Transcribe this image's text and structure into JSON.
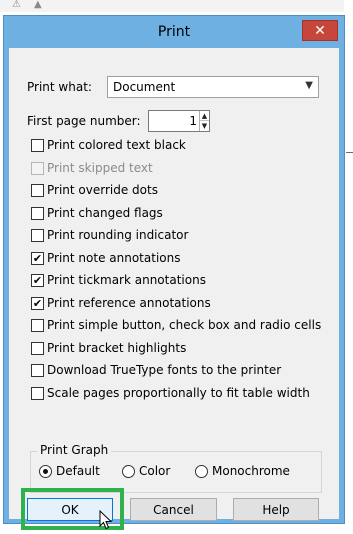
{
  "dialog": {
    "title": "Print",
    "close_glyph": "✕"
  },
  "print_what": {
    "label": "Print what:",
    "value": "Document"
  },
  "first_page": {
    "label": "First page number:",
    "value": "1"
  },
  "options": [
    {
      "label": "Print colored text black",
      "checked": false,
      "enabled": true
    },
    {
      "label": "Print skipped text",
      "checked": false,
      "enabled": false
    },
    {
      "label": "Print override dots",
      "checked": false,
      "enabled": true
    },
    {
      "label": "Print changed flags",
      "checked": false,
      "enabled": true
    },
    {
      "label": "Print rounding indicator",
      "checked": false,
      "enabled": true
    },
    {
      "label": "Print note annotations",
      "checked": true,
      "enabled": true
    },
    {
      "label": "Print tickmark annotations",
      "checked": true,
      "enabled": true
    },
    {
      "label": "Print reference annotations",
      "checked": true,
      "enabled": true
    },
    {
      "label": "Print simple button, check box and radio cells",
      "checked": false,
      "enabled": true
    },
    {
      "label": "Print bracket highlights",
      "checked": false,
      "enabled": true
    },
    {
      "label": "Download TrueType fonts to the printer",
      "checked": false,
      "enabled": true
    },
    {
      "label": "Scale pages proportionally to fit table width",
      "checked": false,
      "enabled": true
    }
  ],
  "print_graph": {
    "title": "Print Graph",
    "options": [
      {
        "label": "Default",
        "selected": true
      },
      {
        "label": "Color",
        "selected": false
      },
      {
        "label": "Monochrome",
        "selected": false
      }
    ]
  },
  "buttons": {
    "ok": "OK",
    "cancel": "Cancel",
    "help": "Help"
  },
  "colors": {
    "title_bar": "#6fb0e2",
    "close_button": "#c7463b",
    "focus_highlight": "#2fb24c",
    "dialog_body": "#f0f0f0"
  }
}
